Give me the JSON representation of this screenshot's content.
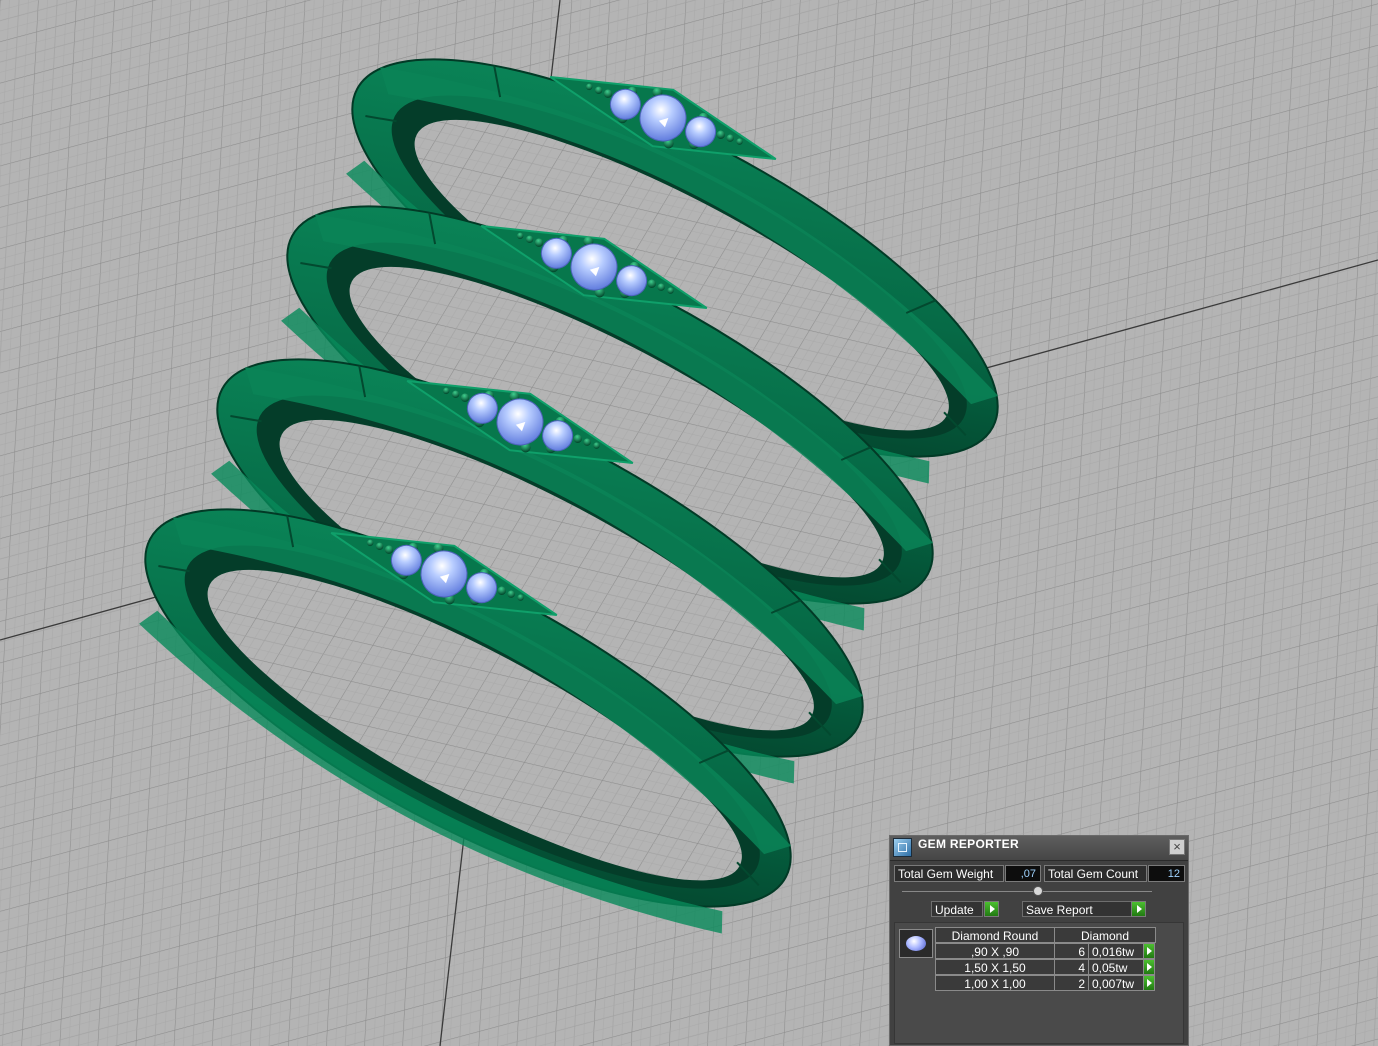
{
  "gem_reporter": {
    "title": "GEM REPORTER",
    "total_weight_label": "Total Gem Weight",
    "total_weight_value": ",07",
    "total_count_label": "Total Gem Count",
    "total_count_value": "12",
    "update_label": "Update",
    "save_report_label": "Save Report",
    "table": {
      "headers": [
        "Diamond Round",
        "Diamond"
      ],
      "rows": [
        {
          "size": ",90 X ,90",
          "count": "6",
          "weight": "0,016tw"
        },
        {
          "size": "1,50 X 1,50",
          "count": "4",
          "weight": "0,05tw"
        },
        {
          "size": "1,00 X 1,00",
          "count": "2",
          "weight": "0,007tw"
        }
      ]
    }
  },
  "icons": {
    "panel": "gem-reporter-icon",
    "close": "close-icon",
    "arrow": "play-arrow-icon",
    "gem": "round-gem-icon"
  },
  "colors": {
    "viewport_bg": "#b4b4b4",
    "grid": "#8c8c8c",
    "ring_green": "#05704a",
    "gem_blue": "#8fb0ff",
    "panel_bg": "#414141",
    "button_green": "#3aa024"
  }
}
